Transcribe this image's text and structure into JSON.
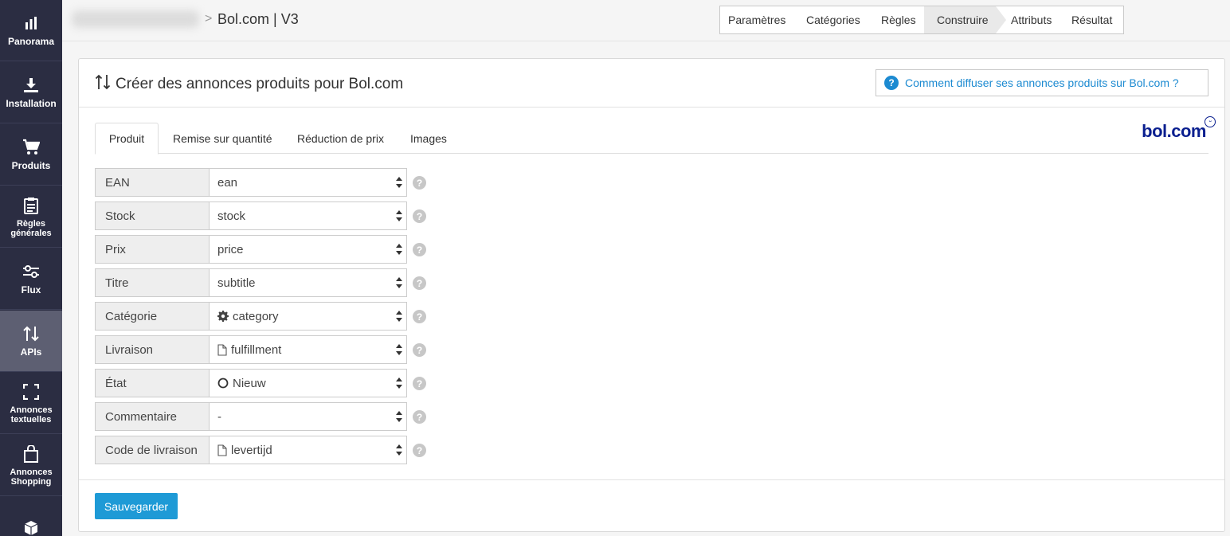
{
  "sidebar": {
    "items": [
      {
        "label": "Panorama",
        "icon": "bar-chart-icon"
      },
      {
        "label": "Installation",
        "icon": "download-icon"
      },
      {
        "label": "Produits",
        "icon": "cart-icon"
      },
      {
        "label": "Règles générales",
        "icon": "clipboard-icon"
      },
      {
        "label": "Flux",
        "icon": "sliders-icon"
      },
      {
        "label": "APIs",
        "icon": "arrows-updown-icon",
        "active": true
      },
      {
        "label": "Annonces textuelles",
        "icon": "expand-icon"
      },
      {
        "label": "Annonces Shopping",
        "icon": "shopping-bag-icon"
      },
      {
        "label": "",
        "icon": "cube-icon"
      }
    ]
  },
  "header": {
    "title": "Bol.com | V3",
    "separator": ">",
    "steps": [
      "Paramètres",
      "Catégories",
      "Règles",
      "Construire",
      "Attributs",
      "Résultat"
    ],
    "active_step": "Construire"
  },
  "panel": {
    "title": "Créer des annonces produits pour Bol.com",
    "help_link": "Comment diffuser ses annonces produits sur Bol.com ?",
    "tabs": [
      "Produit",
      "Remise sur quantité",
      "Réduction de prix",
      "Images"
    ],
    "active_tab": "Produit",
    "logo_text": "bol.com",
    "rows": [
      {
        "label": "EAN",
        "value": "ean",
        "icon": ""
      },
      {
        "label": "Stock",
        "value": "stock",
        "icon": ""
      },
      {
        "label": "Prix",
        "value": "price",
        "icon": ""
      },
      {
        "label": "Titre",
        "value": "subtitle",
        "icon": ""
      },
      {
        "label": "Catégorie",
        "value": "category",
        "icon": "gear-icon"
      },
      {
        "label": "Livraison",
        "value": "fulfillment",
        "icon": "file-icon"
      },
      {
        "label": "État",
        "value": "Nieuw",
        "icon": "circle-icon"
      },
      {
        "label": "Commentaire",
        "value": "-",
        "icon": ""
      },
      {
        "label": "Code de livraison",
        "value": "levertijd",
        "icon": "file-icon"
      }
    ],
    "help_glyph": "?",
    "save_label": "Sauvegarder"
  },
  "colors": {
    "sidebar_bg": "#2b2d42",
    "sidebar_active": "#5d5f72",
    "link_blue": "#1c8ad1",
    "save_button": "#1e9ad6",
    "bol_brand": "#0a1f8f"
  }
}
